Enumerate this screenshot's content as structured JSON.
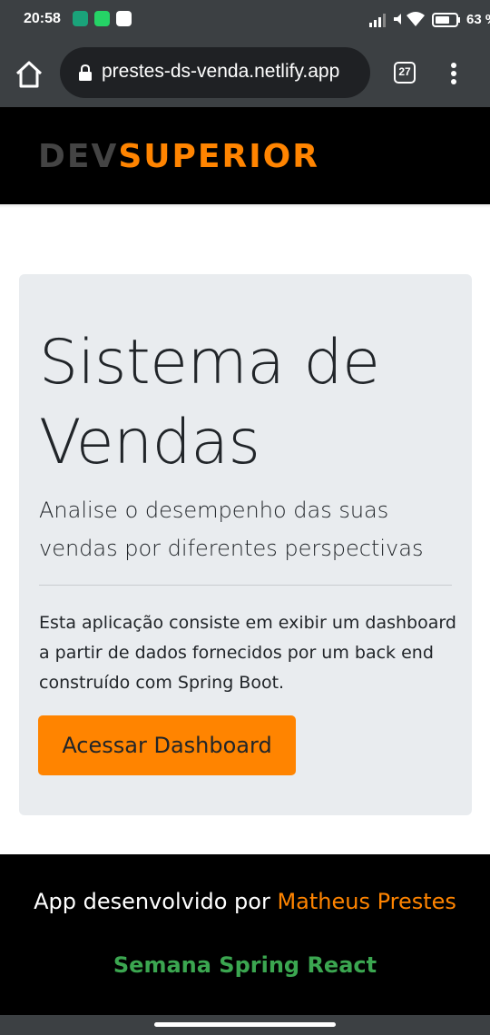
{
  "status_bar": {
    "time": "20:58",
    "battery_text": "63 %",
    "icons": [
      "vpn-shield-icon",
      "whatsapp-icon",
      "app-d-icon",
      "signal-icon",
      "mute-icon",
      "wifi-icon",
      "battery-icon"
    ]
  },
  "browser": {
    "url": "prestes-ds-venda.netlify.app",
    "tab_count": "27",
    "icons": [
      "home-icon",
      "lock-icon",
      "tabs-icon",
      "more-menu-icon"
    ]
  },
  "header": {
    "logo_dev": "DEV",
    "logo_superior": "SUPERIOR"
  },
  "jumbotron": {
    "title": "Sistema de Vendas",
    "lead": "Analise o desempenho das suas vendas por diferentes perspectivas",
    "text": "Esta aplicação consiste em exibir um dashboard a partir de dados fornecidos por um back end construído com Spring Boot.",
    "button_label": "Acessar Dashboard"
  },
  "footer": {
    "developed_by": "App desenvolvido por ",
    "author": "Matheus Prestes",
    "event": "Semana Spring React"
  },
  "colors": {
    "brand_orange": "#ff8400",
    "header_bg": "#000000",
    "jumbotron_bg": "#e9ecef",
    "footer_event_green": "#3ba650",
    "chrome_bar": "#3c4043"
  }
}
